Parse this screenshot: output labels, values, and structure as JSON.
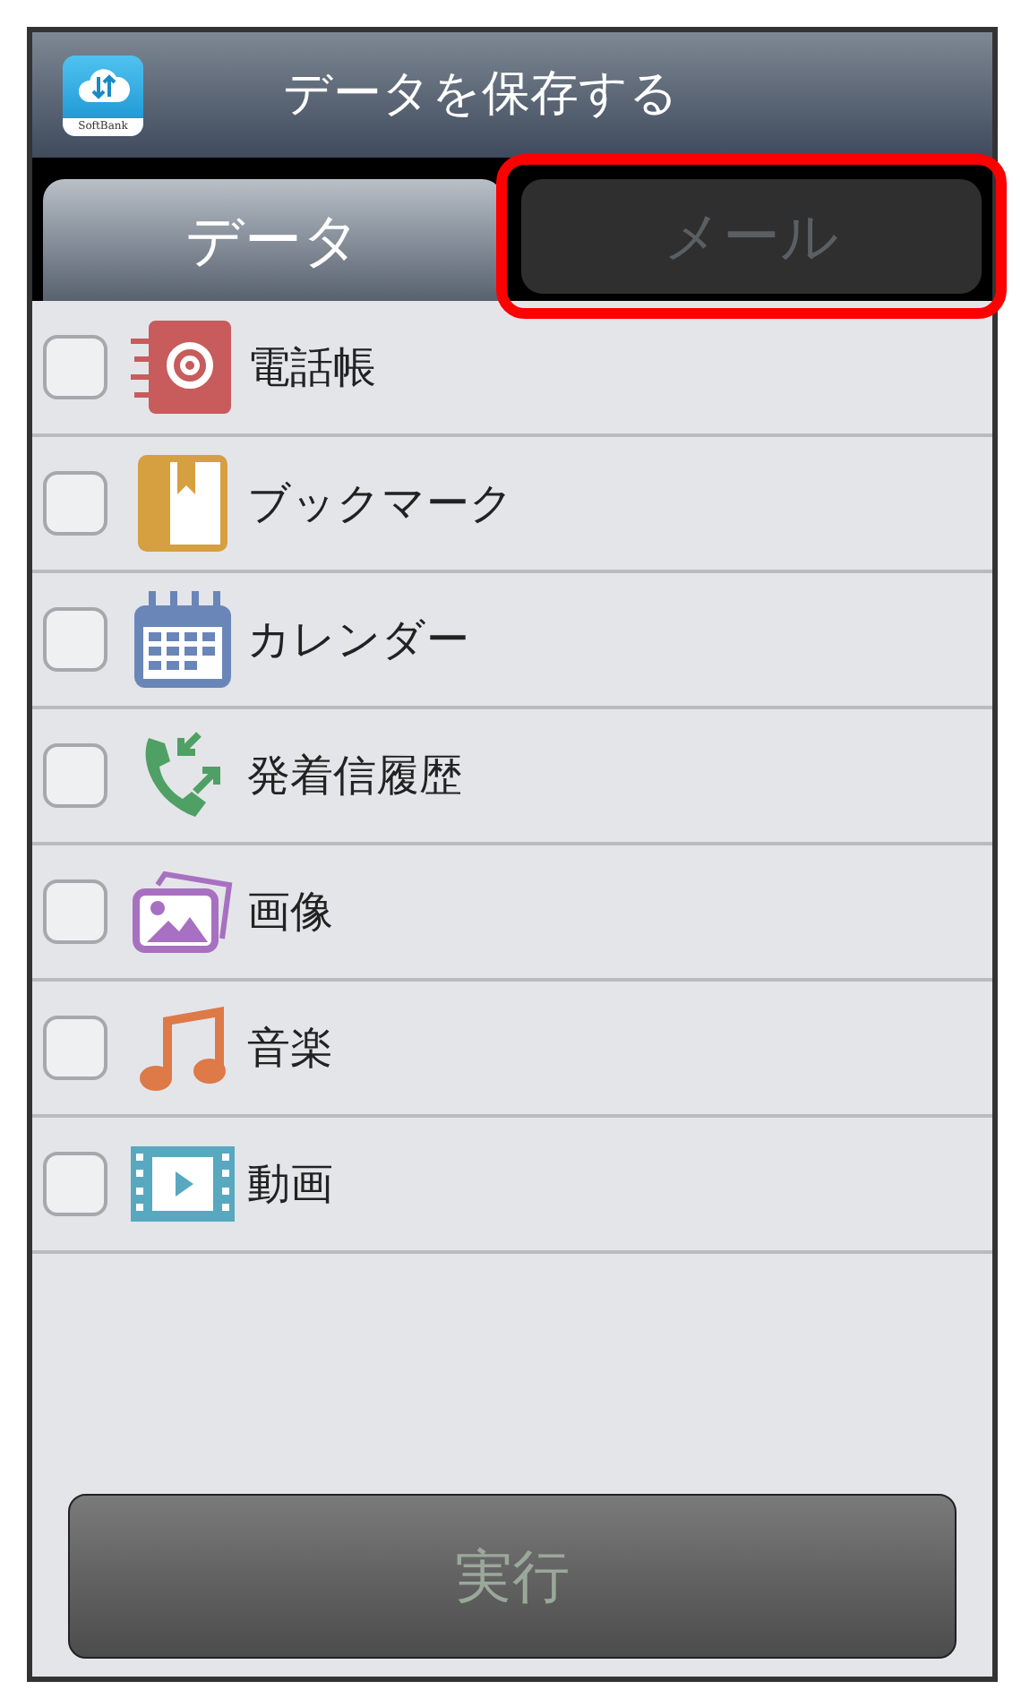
{
  "header": {
    "app_icon_label": "SoftBank",
    "title": "データを保存する"
  },
  "tabs": [
    {
      "label": "データ",
      "selected": true,
      "highlighted": false
    },
    {
      "label": "メール",
      "selected": false,
      "highlighted": true
    }
  ],
  "items": [
    {
      "label": "電話帳",
      "checked": false
    },
    {
      "label": "ブックマーク",
      "checked": false
    },
    {
      "label": "カレンダー",
      "checked": false
    },
    {
      "label": "発着信履歴",
      "checked": false
    },
    {
      "label": "画像",
      "checked": false
    },
    {
      "label": "音楽",
      "checked": false
    },
    {
      "label": "動画",
      "checked": false
    }
  ],
  "action_button": {
    "label": "実行",
    "disabled": true
  }
}
